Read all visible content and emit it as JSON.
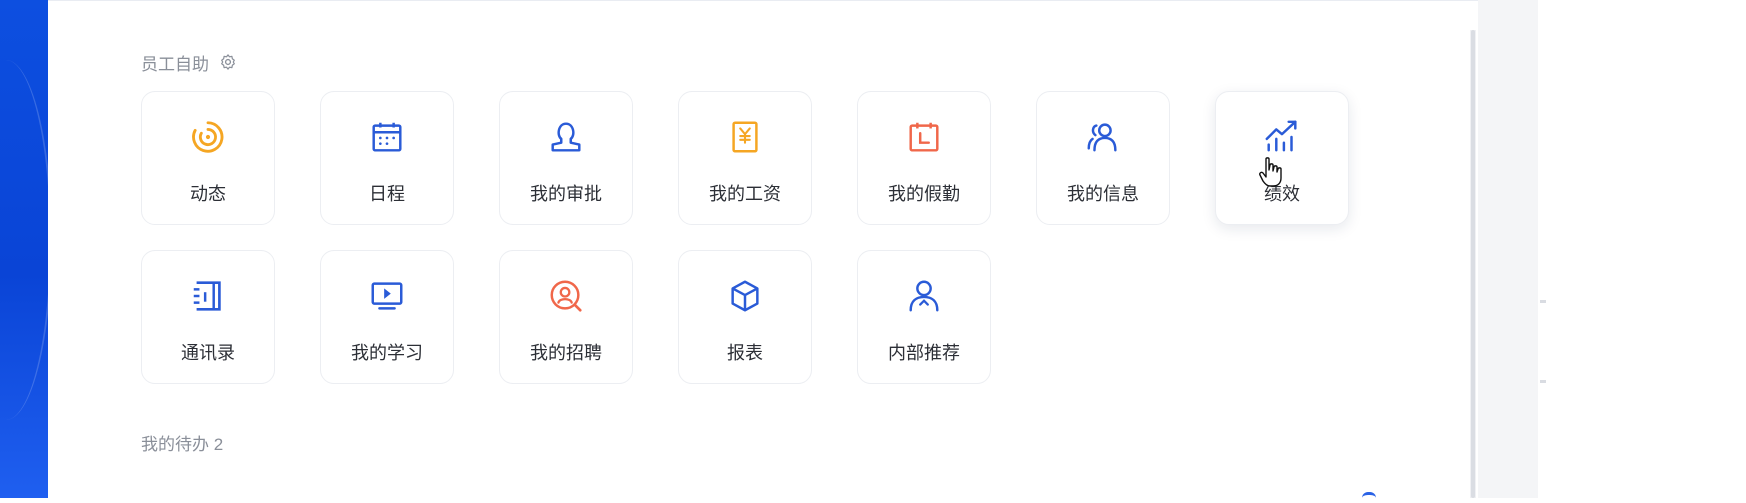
{
  "section": {
    "title": "员工自助"
  },
  "tiles": [
    {
      "label": "动态",
      "icon": "activity-icon",
      "color": "#f5a623"
    },
    {
      "label": "日程",
      "icon": "calendar-icon",
      "color": "#2a5bd7"
    },
    {
      "label": "我的审批",
      "icon": "approval-icon",
      "color": "#2a5bd7"
    },
    {
      "label": "我的工资",
      "icon": "salary-icon",
      "color": "#f5a623"
    },
    {
      "label": "我的假勤",
      "icon": "leave-icon",
      "color": "#f0674a"
    },
    {
      "label": "我的信息",
      "icon": "profile-icon",
      "color": "#2a5bd7"
    },
    {
      "label": "绩效",
      "icon": "performance-icon",
      "color": "#2a5bd7"
    },
    {
      "label": "通讯录",
      "icon": "contacts-icon",
      "color": "#2a5bd7"
    },
    {
      "label": "我的学习",
      "icon": "learning-icon",
      "color": "#2a5bd7"
    },
    {
      "label": "我的招聘",
      "icon": "recruitment-icon",
      "color": "#f0674a"
    },
    {
      "label": "报表",
      "icon": "report-icon",
      "color": "#2a5bd7"
    },
    {
      "label": "内部推荐",
      "icon": "referral-icon",
      "color": "#2a5bd7"
    }
  ],
  "todo": {
    "title": "我的待办 2"
  }
}
